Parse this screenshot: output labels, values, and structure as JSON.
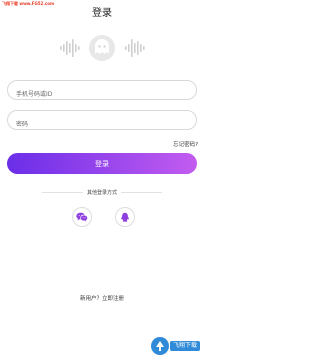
{
  "watermark_top": "飞翔下载 www.FG52.com",
  "header": {
    "title": "登录"
  },
  "form": {
    "phone_placeholder": "手机号码或ID",
    "password_placeholder": "密码",
    "forgot_label": "忘记密码?",
    "login_label": "登录"
  },
  "social": {
    "divider_label": "其他登录方式"
  },
  "footer": {
    "register_label": "新用户？立即注册"
  },
  "watermark_badge": {
    "text": "飞翔下载"
  },
  "colors": {
    "accent_start": "#6a2ee8",
    "accent_end": "#c35cf0",
    "icon_purple": "#8e3fe0"
  }
}
